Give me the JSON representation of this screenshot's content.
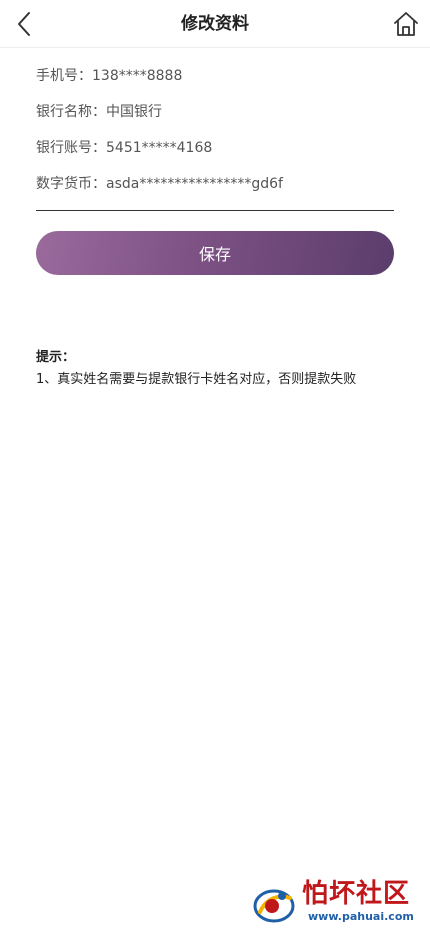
{
  "header": {
    "title": "修改资料",
    "back_icon": "chevron-left-icon",
    "home_icon": "home-icon"
  },
  "info": {
    "phone": "手机号：138****8888",
    "bank_name": "银行名称：中国银行",
    "bank_account": "银行账号：5451*****4168",
    "digital_currency": "数字货币：asda****************gd6f"
  },
  "actions": {
    "save_label": "保存"
  },
  "tips": {
    "title": "提示：",
    "items": [
      "1、真实姓名需要与提款银行卡姓名对应，否则提款失败"
    ]
  },
  "watermark": {
    "name": "怕坏社区",
    "url": "www.pahuai.com"
  },
  "colors": {
    "button_gradient_start": "#9a6a9c",
    "button_gradient_end": "#5b3d6c",
    "watermark_red": "#c0171b",
    "watermark_blue": "#1f5fa8"
  }
}
